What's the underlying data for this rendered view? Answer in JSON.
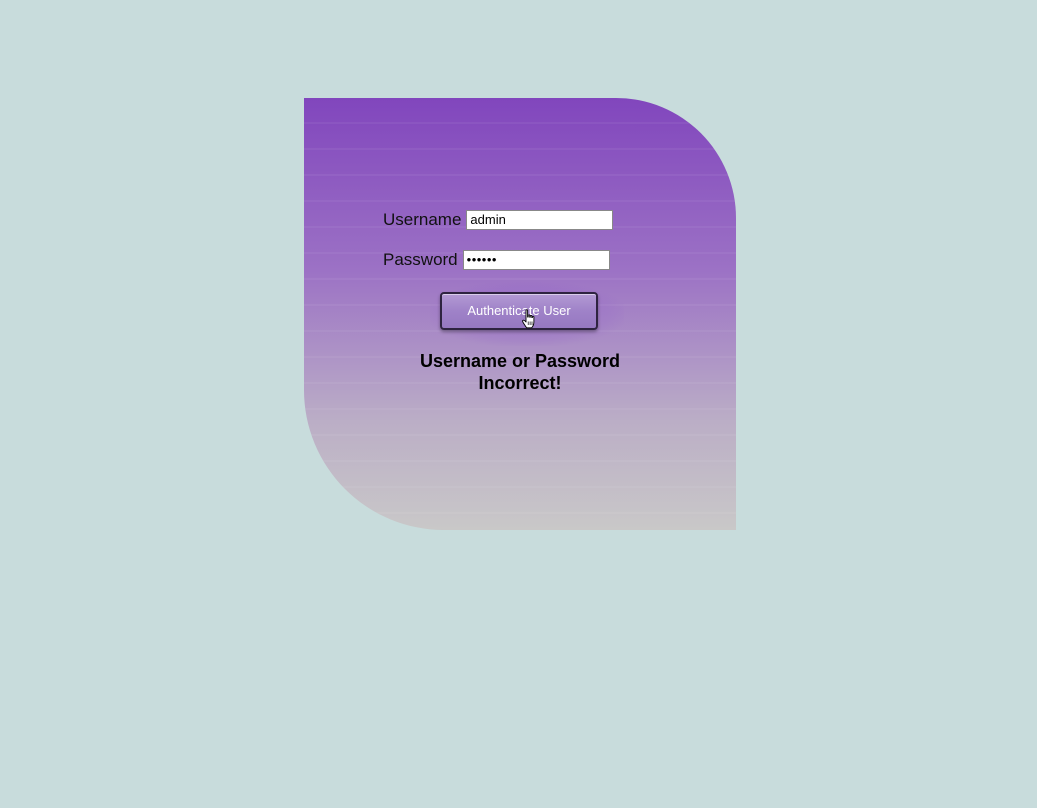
{
  "login": {
    "username_label": "Username",
    "username_value": "admin",
    "password_label": "Password",
    "password_value": "••••••",
    "submit_label": "Authenticate User",
    "error_message": "Username or Password Incorrect!"
  },
  "icons": {
    "cursor": "hand-pointer-icon"
  },
  "colors": {
    "background": "#c8dcdc",
    "card_top": "#8146bd",
    "card_bottom": "#c9c8c8",
    "button": "#9f82c8"
  }
}
